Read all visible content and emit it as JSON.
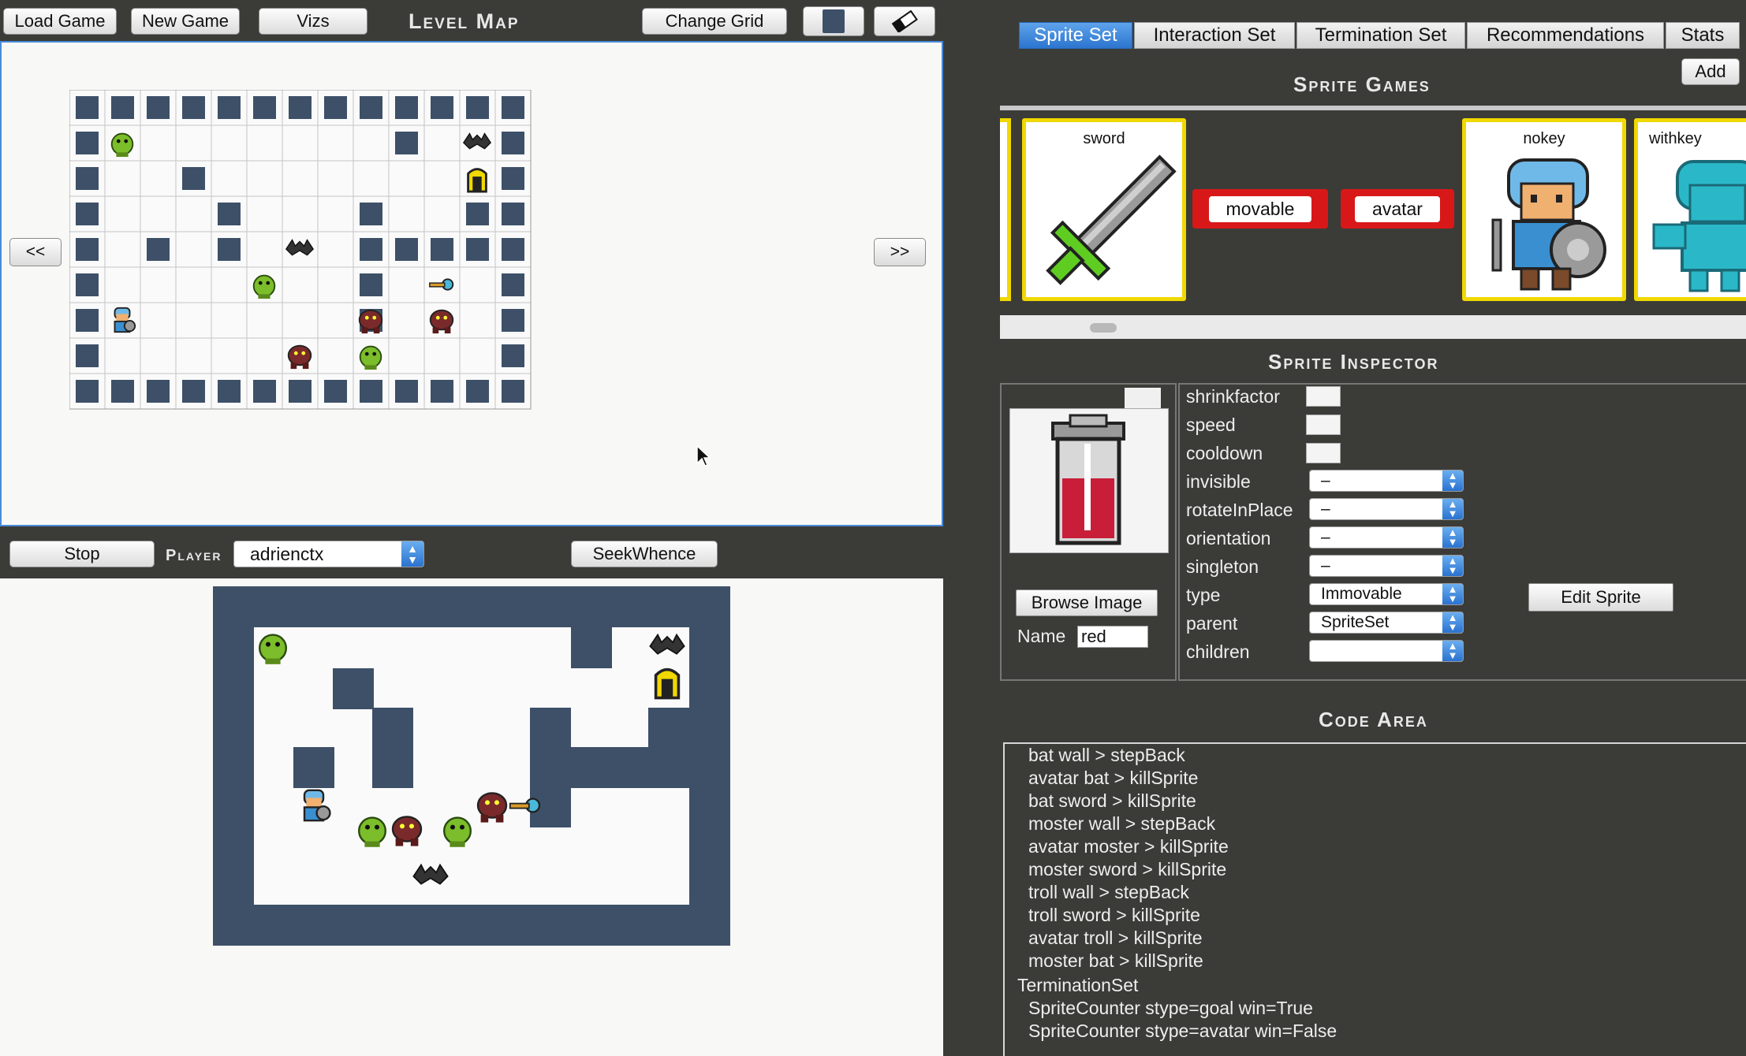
{
  "toolbar": {
    "load_game": "Load Game",
    "new_game": "New Game",
    "vizs": "Vizs",
    "level_map_title": "Level Map",
    "change_grid": "Change Grid"
  },
  "level_nav": {
    "prev": "<<",
    "next": ">>"
  },
  "player_bar": {
    "stop": "Stop",
    "player_label": "Player",
    "player_value": "adrienctx",
    "seek": "SeekWhence"
  },
  "tabs": [
    "Sprite Set",
    "Interaction Set",
    "Termination Set",
    "Recommendations",
    "Stats"
  ],
  "sprite_games": {
    "title": "Sprite Games",
    "add": "Add",
    "cards": [
      "sword",
      "nokey",
      "withkey"
    ],
    "tags": [
      "movable",
      "avatar"
    ]
  },
  "inspector": {
    "title": "Sprite Inspector",
    "browse": "Browse Image",
    "name_label": "Name",
    "name_value": "red",
    "edit": "Edit Sprite",
    "text_props": [
      "shrinkfactor",
      "speed",
      "cooldown"
    ],
    "select_props": [
      {
        "label": "invisible",
        "value": "–"
      },
      {
        "label": "rotateInPlace",
        "value": "–"
      },
      {
        "label": "orientation",
        "value": "–"
      },
      {
        "label": "singleton",
        "value": "–"
      },
      {
        "label": "type",
        "value": "Immovable"
      },
      {
        "label": "parent",
        "value": "SpriteSet"
      },
      {
        "label": "children",
        "value": ""
      }
    ]
  },
  "code_area": {
    "title": "Code Area",
    "lines": [
      "bat wall > stepBack",
      "avatar bat > killSprite",
      "bat sword > killSprite",
      "moster wall > stepBack",
      "avatar moster > killSprite",
      "moster sword > killSprite",
      "troll wall > stepBack",
      "troll sword > killSprite",
      "avatar troll > killSprite",
      "moster bat > killSprite"
    ],
    "section": "TerminationSet",
    "term_lines": [
      "SpriteCounter stype=goal win=True",
      "SpriteCounter stype=avatar win=False"
    ]
  },
  "colors": {
    "accent": "#2c75cf",
    "wall": "#3d5068",
    "card_border": "#f0d800",
    "tag_red": "#d81818"
  }
}
